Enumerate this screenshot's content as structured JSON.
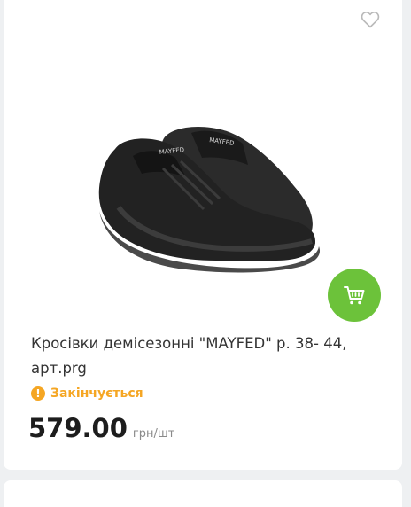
{
  "product": {
    "title": "Кросівки демісезонні \"MAYFED\" р. 38- 44, арт.prg",
    "image_alt": "MAYFED black sneakers",
    "brand_on_shoe": "MAYFED",
    "status_text": "Закінчується",
    "price": "579.00",
    "unit": "грн/шт"
  },
  "icons": {
    "wishlist": "heart-icon",
    "cart": "cart-icon",
    "status": "warning-icon"
  },
  "colors": {
    "cart_button": "#6cc23a",
    "status": "#f5a623",
    "price": "#1d1d1d"
  }
}
